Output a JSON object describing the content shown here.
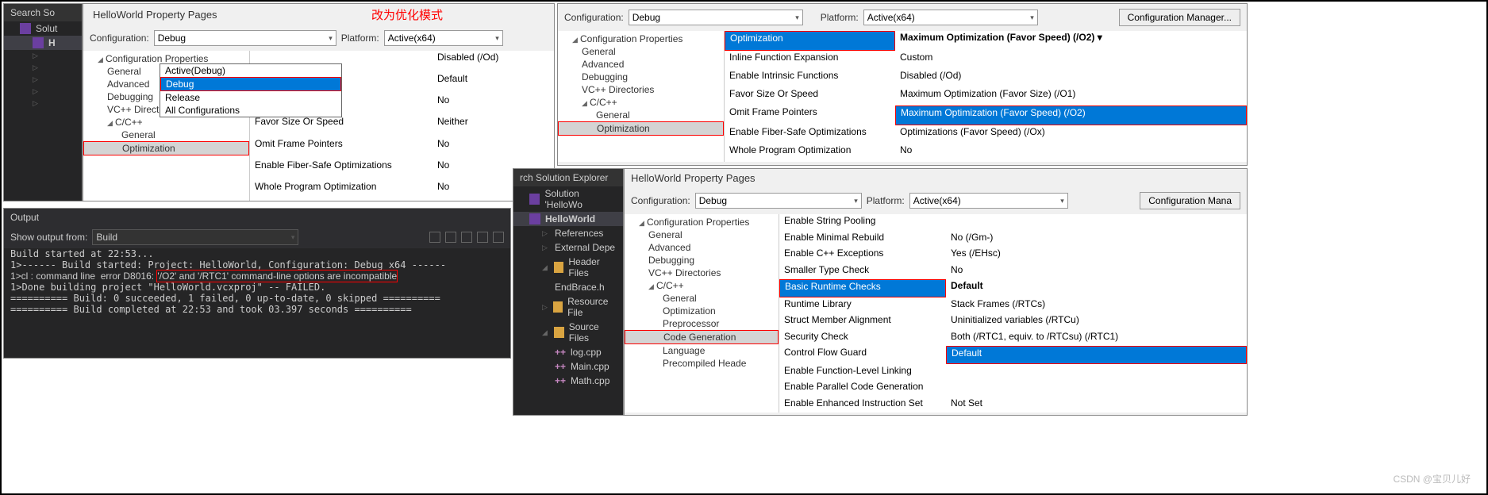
{
  "anno": {
    "chinese": "改为优化模式"
  },
  "p1": {
    "title": "HelloWorld Property Pages",
    "cfgLabel": "Configuration:",
    "cfgValue": "Debug",
    "platLabel": "Platform:",
    "platValue": "Active(x64)",
    "dd": [
      "Active(Debug)",
      "Debug",
      "Release",
      "All Configurations"
    ],
    "tree": {
      "root": "Configuration Properties",
      "general": "General",
      "advanced": "Advanced",
      "debugging": "Debugging",
      "vc": "VC++ Directories",
      "cc": "C/C++",
      "cgen": "General",
      "opt": "Optimization"
    },
    "grid": {
      "k1": "",
      "v1": "Disabled (/Od)",
      "k2": "xpansion",
      "v2": "Default",
      "k3": "unctions",
      "v3": "No",
      "k4": "Favor Size Or Speed",
      "v4": "Neither",
      "k5": "Omit Frame Pointers",
      "v5": "No",
      "k6": "Enable Fiber-Safe Optimizations",
      "v6": "No",
      "k7": "Whole Program Optimization",
      "v7": "No"
    }
  },
  "se1": {
    "search": "Search So",
    "sol": "Solut",
    "proj": "H"
  },
  "out": {
    "title": "Output",
    "showLabel": "Show output from:",
    "showValue": "Build",
    "l1": "Build started at 22:53...",
    "l2": "1>------ Build started: Project: HelloWorld, Configuration: Debug x64 ------",
    "l3a": "1>cl : command line  error D8016: ",
    "l3b": "'/O2' and '/RTC1' command-line options are incompatible",
    "l4": "1>Done building project \"HelloWorld.vcxproj\" -- FAILED.",
    "l5": "========== Build: 0 succeeded, 1 failed, 0 up-to-date, 0 skipped ==========",
    "l6": "========== Build completed at 22:53 and took 03.397 seconds =========="
  },
  "p2": {
    "cfgLabel": "Configuration:",
    "cfgValue": "Debug",
    "platLabel": "Platform:",
    "platValue": "Active(x64)",
    "cfgMgr": "Configuration Manager...",
    "tree": {
      "root": "Configuration Properties",
      "general": "General",
      "advanced": "Advanced",
      "debugging": "Debugging",
      "vc": "VC++ Directories",
      "cc": "C/C++",
      "cgen": "General",
      "opt": "Optimization"
    },
    "grid": {
      "k1": "Optimization",
      "v1": "Maximum Optimization (Favor Speed) (/O2)",
      "k2": "Inline Function Expansion",
      "v2": "Custom",
      "k3": "Enable Intrinsic Functions",
      "v3": "Disabled (/Od)",
      "k4": "Favor Size Or Speed",
      "v4": "Maximum Optimization (Favor Size) (/O1)",
      "k5": "Omit Frame Pointers",
      "v5": "Maximum Optimization (Favor Speed) (/O2)",
      "k6": "Enable Fiber-Safe Optimizations",
      "v6": "Optimizations (Favor Speed) (/Ox)",
      "k7": "Whole Program Optimization",
      "v7": "No"
    }
  },
  "se2": {
    "search": "rch Solution Explorer",
    "sol": "Solution 'HelloWo",
    "proj": "HelloWorld",
    "refs": "References",
    "ext": "External Depe",
    "hdr": "Header Files",
    "hdr1": "EndBrace.h",
    "res": "Resource File",
    "src": "Source Files",
    "s1": "log.cpp",
    "s2": "Main.cpp",
    "s3": "Math.cpp"
  },
  "p3": {
    "title": "HelloWorld Property Pages",
    "cfgLabel": "Configuration:",
    "cfgValue": "Debug",
    "platLabel": "Platform:",
    "platValue": "Active(x64)",
    "cfgMgr": "Configuration Mana",
    "tree": {
      "root": "Configuration Properties",
      "general": "General",
      "advanced": "Advanced",
      "debugging": "Debugging",
      "vc": "VC++ Directories",
      "cc": "C/C++",
      "cgen": "General",
      "opt": "Optimization",
      "pre": "Preprocessor",
      "code": "Code Generation",
      "lang": "Language",
      "prec": "Precompiled Heade"
    },
    "grid": {
      "k1": "Enable String Pooling",
      "v1": "",
      "k2": "Enable Minimal Rebuild",
      "v2": "No (/Gm-)",
      "k3": "Enable C++ Exceptions",
      "v3": "Yes (/EHsc)",
      "k4": "Smaller Type Check",
      "v4": "No",
      "k5": "Basic Runtime Checks",
      "v5": "Default",
      "k6": "Runtime Library",
      "v6": "Stack Frames (/RTCs)",
      "k7": "Struct Member Alignment",
      "v7": "Uninitialized variables (/RTCu)",
      "k8": "Security Check",
      "v8": "Both (/RTC1, equiv. to /RTCsu) (/RTC1)",
      "k9": "Control Flow Guard",
      "v9": "Default",
      "k10": "Enable Function-Level Linking",
      "v10": "",
      "k11": "Enable Parallel Code Generation",
      "v11": "",
      "k12": "Enable Enhanced Instruction Set",
      "v12": "Not Set"
    }
  },
  "watermark": "CSDN @宝贝儿好"
}
